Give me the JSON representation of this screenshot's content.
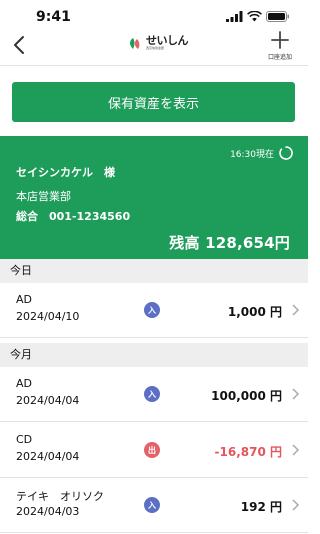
{
  "status": {
    "time": "9:41"
  },
  "header": {
    "logo_text": "せいしん",
    "logo_sub": "西京信用金庫",
    "add_label": "口座追加"
  },
  "actions": {
    "show_assets": "保有資産を表示"
  },
  "account": {
    "as_of": "16:30現在",
    "holder": "セイシンカケル　様",
    "branch": "本店営業部",
    "account_line": "総合　001-1234560",
    "balance": "残高  128,654円"
  },
  "sections": [
    {
      "title": "今日",
      "transactions": [
        {
          "name": "AD",
          "date": "2024/04/10",
          "badge": "入",
          "amount": "1,000 円"
        }
      ]
    },
    {
      "title": "今月",
      "transactions": [
        {
          "name": "AD",
          "date": "2024/04/04",
          "badge": "入",
          "amount": "100,000 円"
        },
        {
          "name": "CD",
          "date": "2024/04/04",
          "badge": "出",
          "amount": "-16,870 円"
        },
        {
          "name": "テイキ　オリソク",
          "date": "2024/04/03",
          "badge": "入",
          "amount": "192 円"
        }
      ]
    }
  ],
  "colors": {
    "brand_green": "#1e9c5a",
    "deposit_badge": "#5b6fc4",
    "withdraw_badge": "#e4616a",
    "negative_amount": "#e4555c"
  },
  "icons": [
    "back-chevron-icon",
    "plus-icon",
    "refresh-icon",
    "signal-icon",
    "wifi-icon",
    "battery-icon",
    "chevron-right-icon"
  ]
}
